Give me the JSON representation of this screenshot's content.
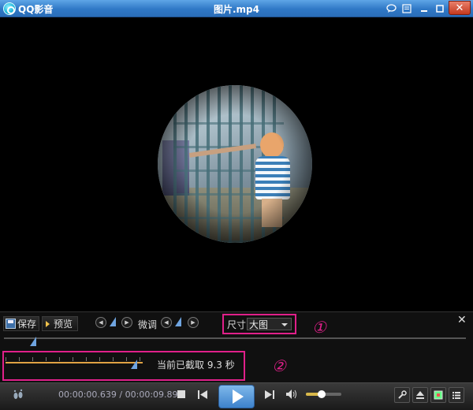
{
  "window": {
    "app_name": "QQ影音",
    "title": "图片.mp4",
    "close_glyph": "✕"
  },
  "edit_panel": {
    "save_label": "保存",
    "preview_label": "预览",
    "fine_tune_label": "微调",
    "size_label": "尺寸",
    "size_value": "大图",
    "close_glyph": "✕",
    "capture_status": "当前已截取 9.3 秒"
  },
  "annotations": {
    "one": "①",
    "two": "②"
  },
  "controls": {
    "current_time": "00:00:00.639",
    "separator": "/",
    "total_time": "00:00:09.899",
    "volume_level": 0.45
  },
  "colors": {
    "highlight": "#e0208a",
    "accent": "#3d82cc"
  }
}
